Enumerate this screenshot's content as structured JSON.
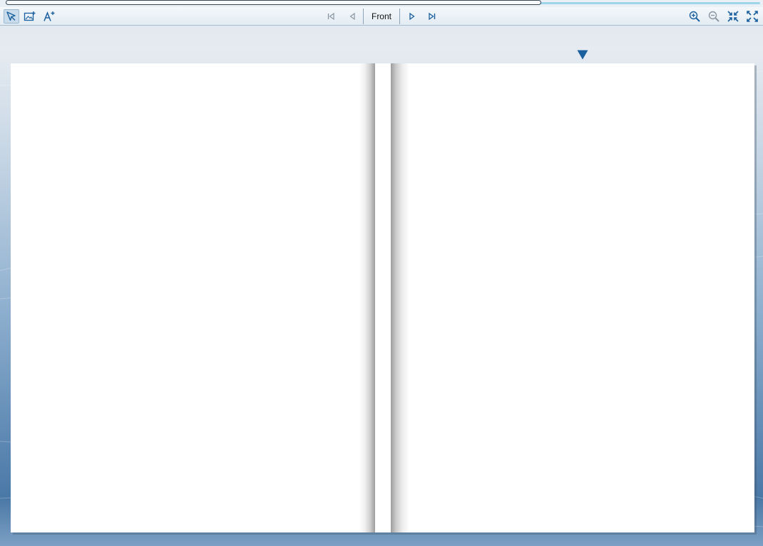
{
  "progress": {
    "fraction": 0.71
  },
  "toolbar": {
    "left_tools": [
      {
        "name": "select-tool",
        "icon": "pointer-icon",
        "active": true
      },
      {
        "name": "add-image-tool",
        "icon": "image-plus-icon",
        "active": false
      },
      {
        "name": "add-text-tool",
        "icon": "text-plus-icon",
        "active": false
      }
    ],
    "navigation": {
      "first_icon": "first-page-icon",
      "prev_icon": "previous-page-icon",
      "current_page_label": "Front",
      "next_icon": "next-page-icon",
      "last_icon": "last-page-icon"
    },
    "right_tools": [
      {
        "name": "zoom-in-button",
        "icon": "zoom-in-icon"
      },
      {
        "name": "zoom-out-button",
        "icon": "zoom-out-icon"
      },
      {
        "name": "fit-page-button",
        "icon": "collapse-icon"
      },
      {
        "name": "fullscreen-button",
        "icon": "expand-icon"
      }
    ]
  },
  "colors": {
    "accent": "#1a5f9e",
    "toolbar_bg": "#eaf1f6",
    "progress_track": "#9fd4ea",
    "page": "#ffffff"
  },
  "marker": {
    "icon": "down-triangle-icon"
  }
}
